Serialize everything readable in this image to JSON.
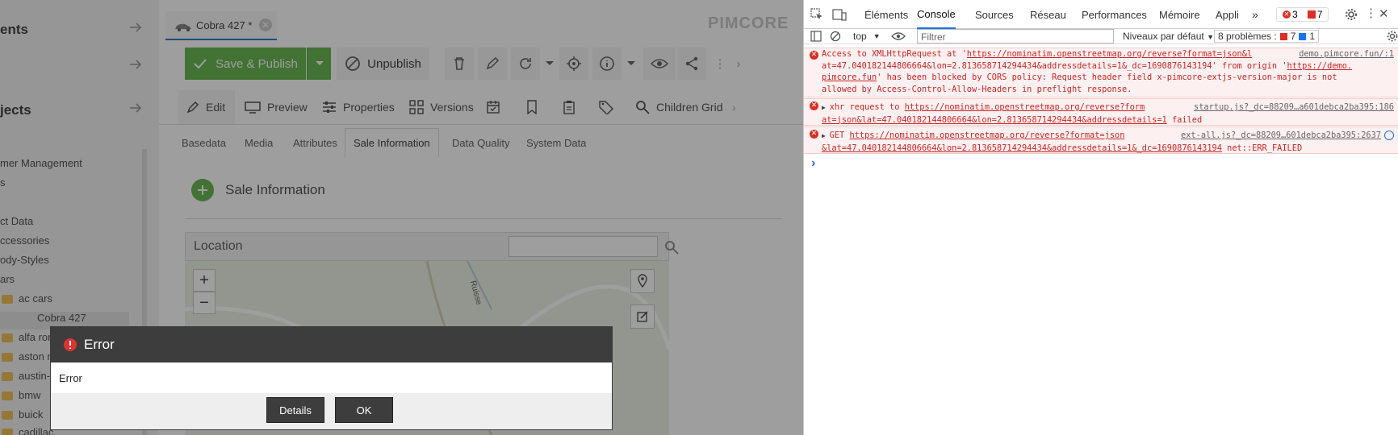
{
  "app": {
    "brand": "PIMCORE",
    "sidebar": {
      "section1": "ents",
      "section2": "",
      "section3": "jects",
      "tree": {
        "customer_management": "mer Management",
        "s_item": "s",
        "product_data": "ct Data",
        "accessories": "ccessories",
        "body_styles": "ody-Styles",
        "cars": "ars",
        "folders": [
          "ac cars",
          "alfa ror",
          "aston m",
          "austin-",
          "bmw",
          "buick",
          "cadillac"
        ],
        "selected": "Cobra 427"
      }
    },
    "doc_tab": "Cobra 427 *",
    "toolbar": {
      "save_publish": "Save & Publish",
      "unpublish": "Unpublish"
    },
    "subtabs": [
      "Edit",
      "Preview",
      "Properties",
      "Versions",
      "Children Grid"
    ],
    "inner_tabs": [
      "Basedata",
      "Media",
      "Attributes",
      "Sale Information",
      "Data Quality",
      "System Data"
    ],
    "panel_title": "Sale Information",
    "location_label": "Location",
    "map_text": "Ruisse",
    "map_zoom_in": "+",
    "map_zoom_out": "−"
  },
  "dialog": {
    "title": "Error",
    "message": "Error",
    "details_button": "Details",
    "ok_button": "OK"
  },
  "devtools": {
    "tabs": [
      "Éléments",
      "Console",
      "Sources",
      "Réseau",
      "Performances",
      "Mémoire",
      "Appli"
    ],
    "active_tab": "Console",
    "error_count": "3",
    "warning_count": "7",
    "context": "top",
    "filter_placeholder": "Filtrer",
    "levels": "Niveaux par défaut",
    "problems_label": "8 problèmes :",
    "problems_errors": "7",
    "problems_info": "1",
    "messages": [
      {
        "line1_a": "Access to XMLHttpRequest at '",
        "line1_url": "https://nominatim.openstreetmap.org/reverse?format=json&l",
        "line1_src": "demo.pimcore.fun/:1",
        "line2": "at=47.040182144806664&lon=2.813658714294434&addressdetails=1&_dc=1690876143194' from origin '",
        "line2_origin": "https://demo.",
        "line3_origin": "pimcore.fun",
        "line3": "' has been blocked by CORS policy: Request header field x-pimcore-extjs-version-major is not",
        "line4": "allowed by Access-Control-Allow-Headers in preflight response."
      },
      {
        "prefix": "xhr request to ",
        "url": "https://nominatim.openstreetmap.org/reverse?form",
        "src": "startup.js?_dc=88209…a601debca2ba395:186",
        "line2_url": "at=json&lat=47.040182144806664&lon=2.813658714294434&addressdetails=1",
        "line2_suffix": " failed"
      },
      {
        "prefix": "GET ",
        "url": "https://nominatim.openstreetmap.org/reverse?format=json",
        "src": "ext-all.js?_dc=88209…601debca2ba395:2637",
        "line2_url": "&lat=47.040182144806664&lon=2.813658714294434&addressdetails=1&_dc=1690876143194",
        "line2_suffix": " net::ERR_FAILED"
      }
    ],
    "prompt": "›"
  }
}
